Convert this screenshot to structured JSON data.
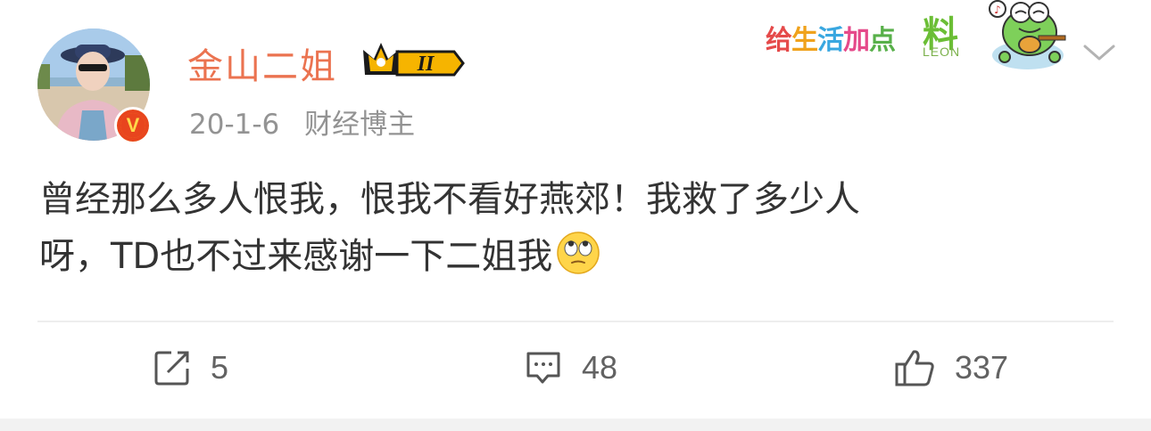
{
  "post": {
    "author": {
      "name": "金山二姐",
      "level_badge": "II",
      "verified_icon": "v-verified-icon"
    },
    "date": "20-1-6",
    "category": "财经博主",
    "text_line1": "曾经那么多人恨我，恨我不看好燕郊！我救了多少人",
    "text_line2": "呀，TD也不过来感谢一下二姐我",
    "emoji_icon": "eye-roll-emoji-icon",
    "decoration": {
      "chars": [
        "给",
        "生",
        "活",
        "加",
        "点"
      ],
      "big_char": "料",
      "small_text": "LEON"
    },
    "actions": {
      "repost_count": "5",
      "comment_count": "48",
      "like_count": "337"
    }
  },
  "colors": {
    "username": "#eb7350",
    "meta": "#939393",
    "text": "#333333",
    "action": "#626262"
  }
}
